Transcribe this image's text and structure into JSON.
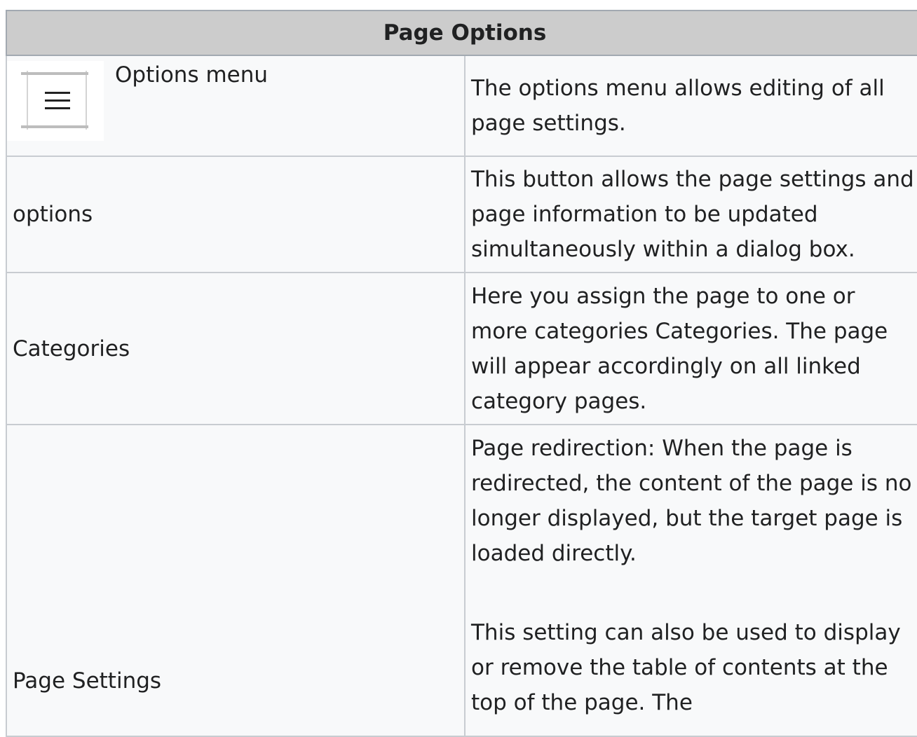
{
  "table": {
    "header": "Page Options",
    "rows": [
      {
        "label": "Options menu",
        "icon": "hamburger-menu-icon",
        "description": [
          "The options menu allows editing of all page settings."
        ]
      },
      {
        "label": "options",
        "description": [
          "This button allows the page settings and page information to be updated simultaneously within a dialog box."
        ]
      },
      {
        "label": "Categories",
        "description": [
          "Here you assign the page to one or more categories Categories. The page will appear accordingly on all linked category pages."
        ]
      },
      {
        "label": "Page Settings",
        "description": [
          "Page redirection: When the page is redirected, the content of the page is no longer displayed, but the target page is loaded directly.",
          "This setting can also be used to display or remove the table of contents at the top of the page. The"
        ]
      }
    ]
  }
}
